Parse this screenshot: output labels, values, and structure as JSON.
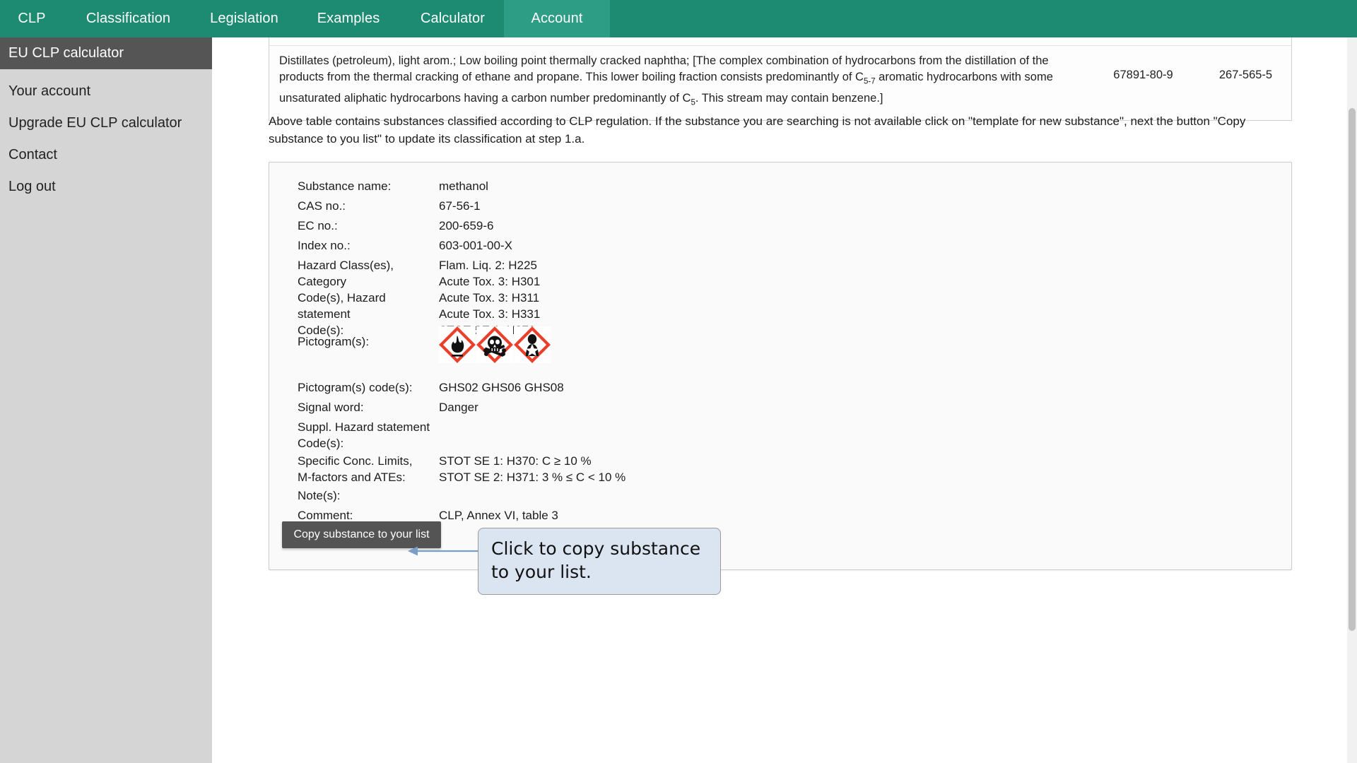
{
  "topnav": {
    "items": [
      {
        "label": "CLP",
        "active": false
      },
      {
        "label": "Classification",
        "active": false
      },
      {
        "label": "Legislation",
        "active": false
      },
      {
        "label": "Examples",
        "active": false
      },
      {
        "label": "Calculator",
        "active": false
      },
      {
        "label": "Account",
        "active": true
      }
    ],
    "background_color": "#1d8a72",
    "active_color": "#2e9d85"
  },
  "sidebar": {
    "items": [
      {
        "label": "EU CLP calculator",
        "active": true
      },
      {
        "label": "Your account",
        "active": false
      },
      {
        "label": "Upgrade EU CLP calculator",
        "active": false
      },
      {
        "label": "Contact",
        "active": false
      },
      {
        "label": "Log out",
        "active": false
      }
    ],
    "background_color": "#d5d5d5",
    "active_color": "#555555"
  },
  "result_table": {
    "rows": [
      {
        "description": "unsaturated aliphatic hydrocarbons having carbon number predominantly of C5. This stream may contain benzene.]",
        "cas": "",
        "ec": ""
      },
      {
        "description": "Distillates (petroleum), light arom.; Low boiling point thermally cracked naphtha; [The complex combination of hydrocarbons from the distillation of the products from the thermal cracking of ethane and propane. This lower boiling fraction consists predominantly of C5-7 aromatic hydrocarbons with some unsaturated aliphatic hydrocarbons having a carbon number predominantly of C5. This stream may contain benzene.]",
        "cas": "67891-80-9",
        "ec": "267-565-5"
      }
    ]
  },
  "note_paragraph": "Above table contains substances classified according to CLP regulation. If the substance you are searching is not available click on \"template for new substance\", next the button \"Copy substance to you list\" to update its classification at step 1.a.",
  "substance": {
    "fields": [
      {
        "label": "Substance name:",
        "value": "methanol"
      },
      {
        "label": "CAS no.:",
        "value": "67-56-1"
      },
      {
        "label": "EC no.:",
        "value": "200-659-6"
      },
      {
        "label": "Index no.:",
        "value": "603-001-00-X"
      },
      {
        "label": "Hazard Class(es), Category\nCode(s), Hazard statement\nCode(s):",
        "value": "Flam. Liq. 2: H225\nAcute Tox. 3: H301\nAcute Tox. 3: H311\nAcute Tox. 3: H331\nSTOT SE 1: H370"
      },
      {
        "label": "Pictogram(s) code(s):",
        "value": " GHS02  GHS06  GHS08"
      },
      {
        "label": "Signal word:",
        "value": "Danger"
      },
      {
        "label": "Suppl. Hazard statement\nCode(s):",
        "value": ""
      },
      {
        "label": "Specific Conc. Limits,\nM-factors and ATEs:",
        "value": "STOT SE 1: H370: C ≥ 10 %\nSTOT SE 2: H371: 3 % ≤ C < 10 %"
      },
      {
        "label": "Note(s):",
        "value": ""
      },
      {
        "label": "Comment:",
        "value": "CLP, Annex VI, table 3"
      }
    ],
    "pictogram_label": "Pictogram(s):",
    "pictograms": [
      {
        "code": "GHS02",
        "name": "flame-pictogram"
      },
      {
        "code": "GHS06",
        "name": "skull-and-crossbones-pictogram"
      },
      {
        "code": "GHS08",
        "name": "health-hazard-pictogram"
      }
    ],
    "copy_button_label": "Copy substance to your list"
  },
  "callout": {
    "text": "Click to copy substance\nto your list.",
    "background_color": "#dbe5f1",
    "border_color": "#9a9a9a",
    "arrow_color": "#7b9ec9"
  }
}
